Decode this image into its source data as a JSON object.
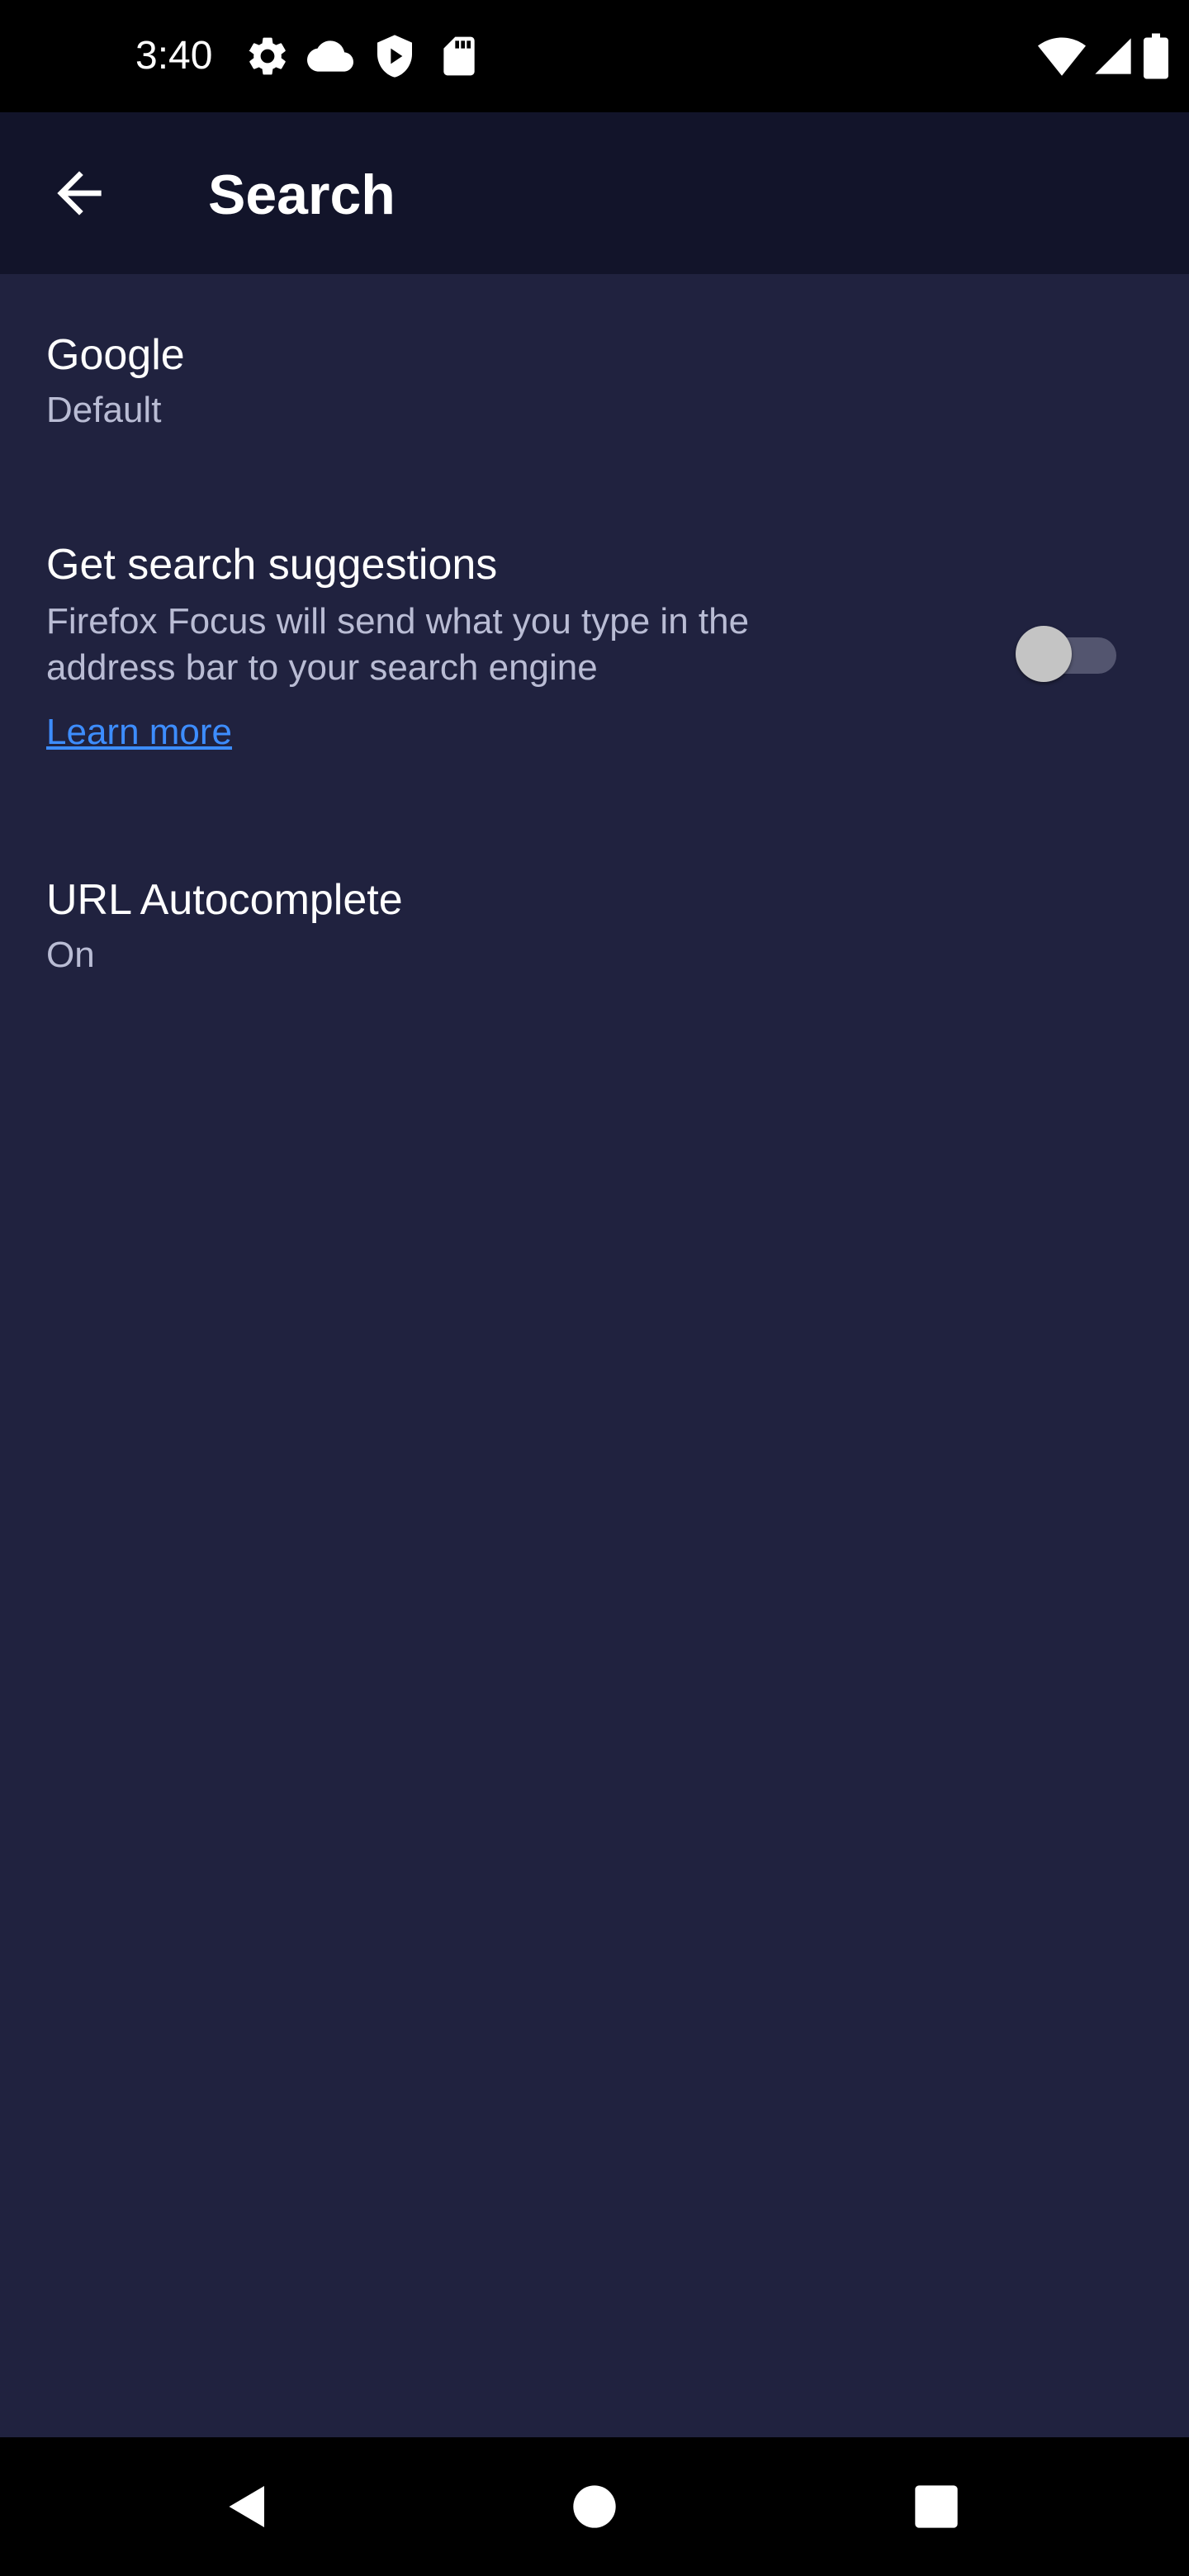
{
  "status_bar": {
    "time": "3:40",
    "left_icons": [
      "gear-icon",
      "cloud-icon",
      "shield-play-icon",
      "sd-card-icon"
    ],
    "right_icons": [
      "wifi-icon",
      "cell-signal-icon",
      "battery-icon"
    ]
  },
  "app_bar": {
    "back_icon": "arrow-left-icon",
    "title": "Search"
  },
  "settings": {
    "search_engine": {
      "title": "Google",
      "summary": "Default"
    },
    "search_suggestions": {
      "title": "Get search suggestions",
      "summary_line1": "Firefox Focus will send what you type in the",
      "summary_line2": "address bar to your search engine",
      "learn_more": "Learn more",
      "enabled": false
    },
    "url_autocomplete": {
      "title": "URL Autocomplete",
      "summary": "On"
    }
  },
  "nav_bar": {
    "icons": [
      "nav-back-icon",
      "nav-home-icon",
      "nav-recents-icon"
    ]
  },
  "colors": {
    "background": "#20223f",
    "app_bar": "#12142a",
    "link": "#3d8dff",
    "secondary_text": "#b9bcd4",
    "toggle_track_off": "#53556f",
    "toggle_thumb_off": "#c4c4c4"
  }
}
